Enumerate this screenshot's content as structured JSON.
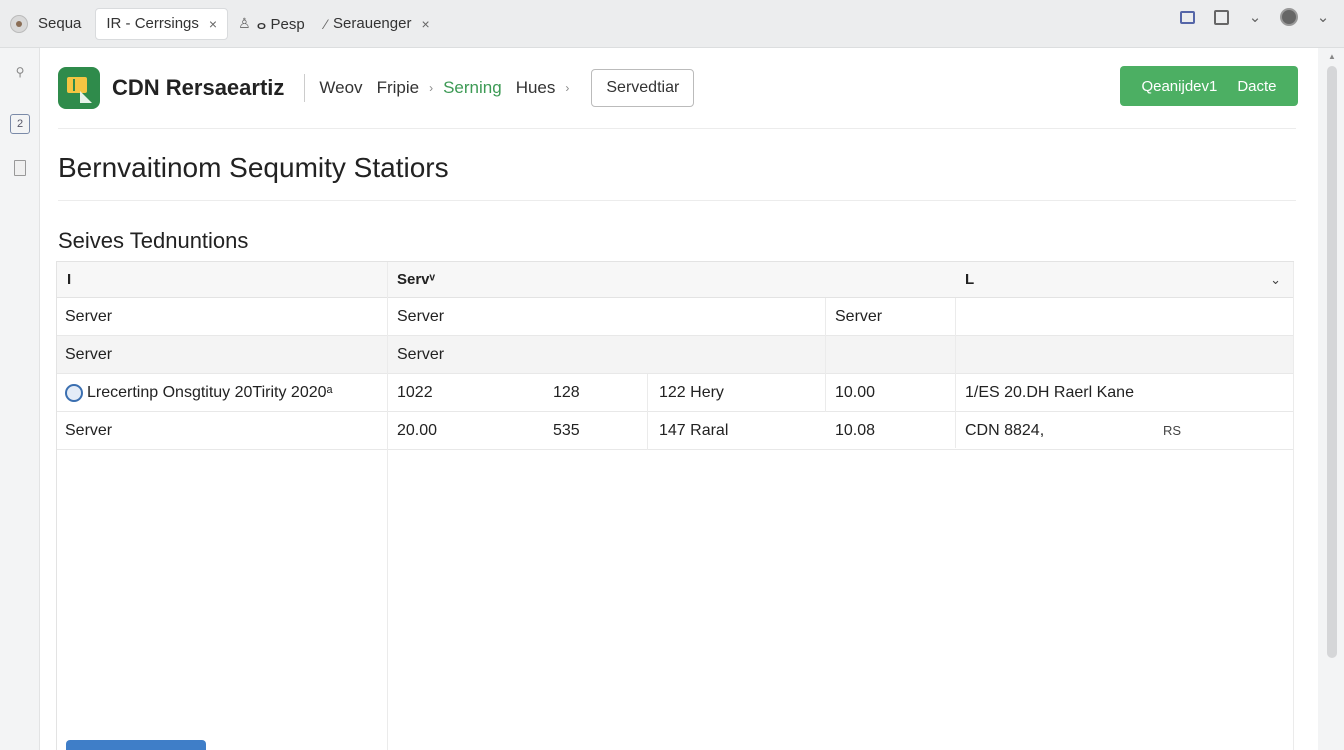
{
  "tabs": [
    {
      "label": "Sequa"
    },
    {
      "label": "IR - Cerrsings",
      "close": "×"
    },
    {
      "label": "ⴰ Pesp",
      "prefix_icon": "user-icon"
    },
    {
      "label": "Serauenger",
      "prefix_icon": "pin-icon",
      "close": "×"
    }
  ],
  "rail": {
    "badge": "2"
  },
  "header": {
    "app_title": "CDN Rersaeartiz",
    "breadcrumbs": [
      "Weov",
      "Fripie",
      "Serning",
      "Hues"
    ],
    "service_button": "Servedtiar",
    "primary_button": {
      "left": "Qeanijdev1",
      "right": "Dacte"
    },
    "accent_color": "#4caf63"
  },
  "page_title": "Bernvaitinom Sequmity Statiors",
  "section_title": "Seives Tednuntions",
  "table": {
    "headers": {
      "c1": "I",
      "c2": "Servᵛ",
      "c6": "L"
    },
    "rows": [
      {
        "c1": "Server",
        "c2": "Server",
        "c5": "Server",
        "alt": false
      },
      {
        "c1": "Server",
        "c2": "Server",
        "alt": true
      },
      {
        "c1": "Lrecertinp Onsgtituy 20Tirity 2020ᵃ",
        "c2": "1022",
        "c3": "128",
        "c4": "122 Hery",
        "c5": "10.00",
        "c6": "1/ES 20.DH Raerl Kane",
        "has_icon": true,
        "alt": false
      },
      {
        "c1": "Server",
        "c2": "20.00",
        "c3": "535",
        "c4": "147 Raral",
        "c5": "10.08",
        "c6": "CDN 8824,",
        "c7": "RS",
        "alt": false
      }
    ]
  }
}
